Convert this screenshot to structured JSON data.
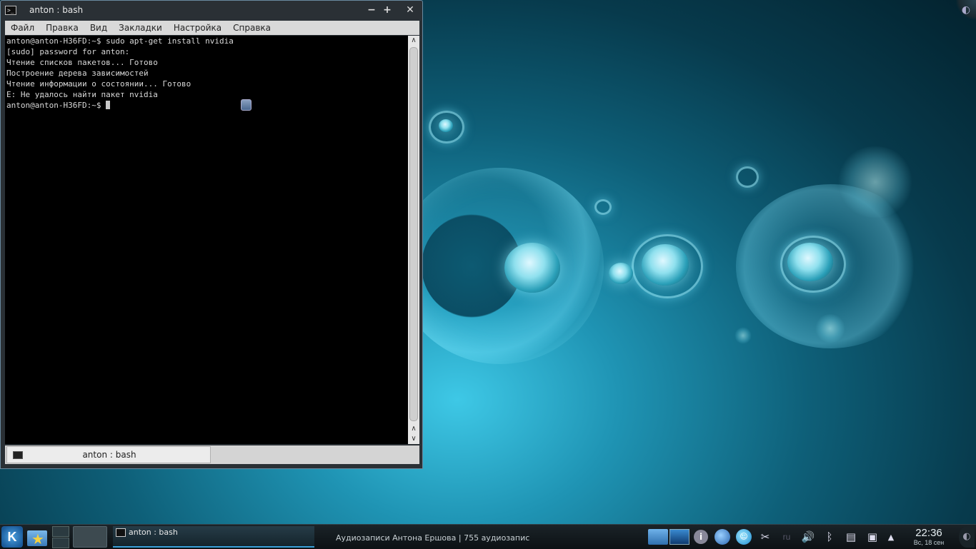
{
  "window": {
    "title": "anton : bash",
    "buttons": {
      "minimize": "−",
      "maximize": "+",
      "close": "✕"
    }
  },
  "menu": [
    "Файл",
    "Правка",
    "Вид",
    "Закладки",
    "Настройка",
    "Справка"
  ],
  "terminal": {
    "lines": [
      "anton@anton-H36FD:~$ sudo apt-get install nvidia",
      "[sudo] password for anton:",
      "Чтение списков пакетов... Готово",
      "Построение дерева зависимостей",
      "Чтение информации о состоянии... Готово",
      "E: Не удалось найти пакет nvidia"
    ],
    "prompt": "anton@anton-H36FD:~$ "
  },
  "scrollbar": {
    "up": "∧",
    "down": "∨"
  },
  "tab": {
    "label": "anton : bash"
  },
  "taskbar": {
    "kmenu": "K",
    "tasks": [
      "anton : bash",
      "Аудиозаписи Антона Ершова | 755 аудиозапис"
    ],
    "tray_ru": "ru",
    "clock_time": "22:36",
    "clock_date": "Вс, 18 сен"
  },
  "colors": {
    "accent": "#3aa0d8",
    "terminal_bg": "#000000",
    "terminal_fg": "#d8d8d8"
  }
}
